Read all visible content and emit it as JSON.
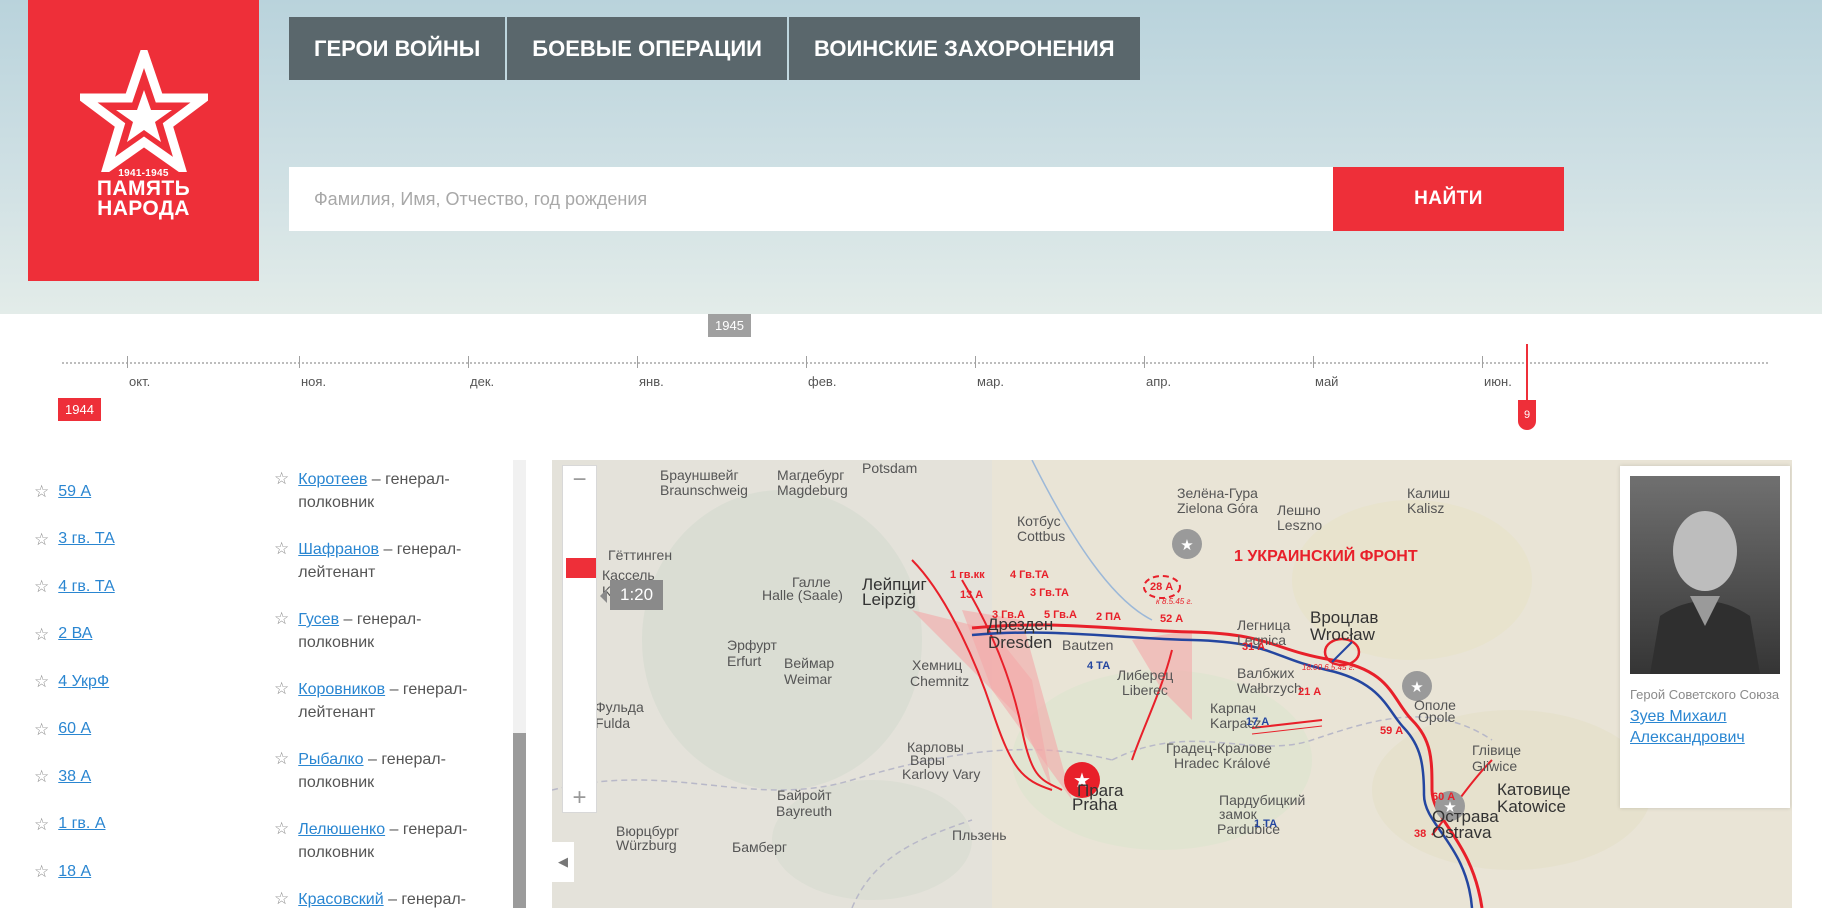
{
  "brand": {
    "years": "1941-1945",
    "line1": "ПАМЯТЬ",
    "line2": "НАРОДА"
  },
  "nav": [
    {
      "label": "ГЕРОИ ВОЙНЫ"
    },
    {
      "label": "БОЕВЫЕ ОПЕРАЦИИ"
    },
    {
      "label": "ВОИНСКИЕ ЗАХОРОНЕНИЯ"
    }
  ],
  "search": {
    "placeholder": "Фамилия, Имя, Отчество, год рождения",
    "value": "",
    "button": "НАЙТИ"
  },
  "timeline": {
    "year_start": "1944",
    "year_mid": "1945",
    "months": [
      "окт.",
      "ноя.",
      "дек.",
      "янв.",
      "фев.",
      "мар.",
      "апр.",
      "май",
      "июн."
    ],
    "current_day": "9"
  },
  "armies": [
    {
      "label": "59 А"
    },
    {
      "label": "3 гв. ТА"
    },
    {
      "label": "4 гв. ТА"
    },
    {
      "label": "2 ВА"
    },
    {
      "label": "4 УкрФ"
    },
    {
      "label": "60 А"
    },
    {
      "label": "38 А"
    },
    {
      "label": "1 гв. А"
    },
    {
      "label": "18 А"
    }
  ],
  "commanders": [
    {
      "name": "Коротеев",
      "rank": " – генерал-полковник"
    },
    {
      "name": "Шафранов",
      "rank": " – генерал-лейтенант"
    },
    {
      "name": "Гусев",
      "rank": " – генерал-полковник"
    },
    {
      "name": "Коровников",
      "rank": " – генерал-лейтенант"
    },
    {
      "name": "Рыбалко",
      "rank": " – генерал-полковник"
    },
    {
      "name": "Лелюшенко",
      "rank": " – генерал-полковник"
    },
    {
      "name": "Красовский",
      "rank": " – генерал-полковник"
    }
  ],
  "map": {
    "zoom_label": "1:20",
    "zoom_in": "+",
    "zoom_out": "−",
    "front_label": "1 УКРАИНСКИЙ ФРОНТ",
    "cities": [
      "Магдебург",
      "Magdeburg",
      "Брауншвейг",
      "Braunschweig",
      "Potsdam",
      "Зелёна-Гура",
      "Zielona Góra",
      "Лешно",
      "Leszno",
      "Калиш",
      "Kalisz",
      "Котбус",
      "Cottbus",
      "Гёттинген",
      "Кассель",
      "Kassel",
      "Галле",
      "Halle (Saale)",
      "Лейпциг",
      "Leipzig",
      "Дрезден",
      "Dresden",
      "Bautzen",
      "Легница",
      "Legnica",
      "Вроцлав",
      "Wrocław",
      "Эрфурт",
      "Erfurt",
      "Веймар",
      "Weimar",
      "Хемниц",
      "Chemnitz",
      "Либерец",
      "Liberec",
      "Валбжих",
      "Wałbrzych",
      "Ополе",
      "Opole",
      "Фульда",
      "Fulda",
      "Карпач",
      "Karpacz",
      "Градец-Кралове",
      "Hradec Králové",
      "Карловы",
      "Вары",
      "Karlovy Vary",
      "Глівице",
      "Gliwice",
      "Катовице",
      "Katowice",
      "Байройт",
      "Bayreuth",
      "Прага",
      "Praha",
      "Пардубицкий",
      "замок",
      "Pardubice",
      "Вюрцбург",
      "Würzburg",
      "Бамберг",
      "Пльзень",
      "Острава",
      "Ostrava"
    ],
    "army_labels": [
      "1 гв.кк",
      "4 Гв.ТА",
      "13 А",
      "3 Гв.ТА",
      "3 Гв.А",
      "5 Гв.А",
      "2 ПА",
      "52 А",
      "28 А",
      "31 А",
      "4 ТА",
      "21 А",
      "17 А",
      "59 А",
      "60 А",
      "1 ТА",
      "38"
    ],
    "time_labels": [
      "к 8.5.45 г.",
      "18.00 6.5.45 г."
    ]
  },
  "hero_card": {
    "subtitle": "Герой Советского Союза",
    "name": "Зуев Михаил Александрович"
  },
  "colors": {
    "accent": "#ee2f39",
    "nav": "#5a676c",
    "link": "#2a86d1",
    "soviet_red": "#e8202a",
    "german_blue": "#2446a0"
  }
}
